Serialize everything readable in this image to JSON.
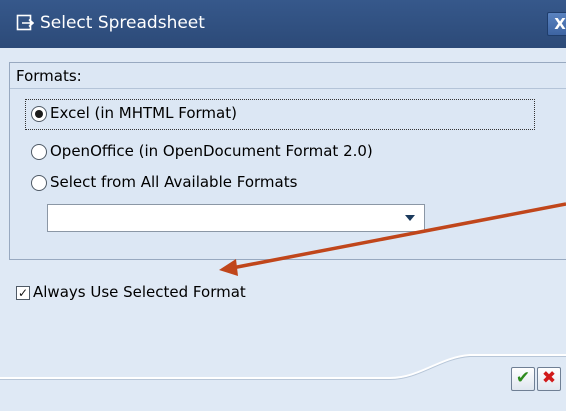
{
  "dialog": {
    "title": "Select Spreadsheet",
    "close_glyph": "X"
  },
  "formats": {
    "group_label": "Formats:",
    "options": [
      {
        "label": "Excel (in MHTML Format)",
        "selected": true
      },
      {
        "label": "OpenOffice (in OpenDocument Format 2.0)",
        "selected": false
      },
      {
        "label": "Select from All Available Formats",
        "selected": false
      }
    ],
    "dropdown_value": ""
  },
  "always_use": {
    "label": "Always Use Selected Format",
    "checked": true,
    "check_glyph": "✓"
  },
  "buttons": {
    "ok_glyph": "✔",
    "cancel_glyph": "✖"
  },
  "colors": {
    "title_bar": "#2c4a78",
    "dialog_bg": "#dfe9f5",
    "annotation_arrow": "#c0461b",
    "ok_green": "#2e8b1e",
    "cancel_red": "#d11a1a"
  },
  "icons": {
    "title_icon": "export-dialog-icon",
    "annotation": "red-arrow-annotation"
  }
}
